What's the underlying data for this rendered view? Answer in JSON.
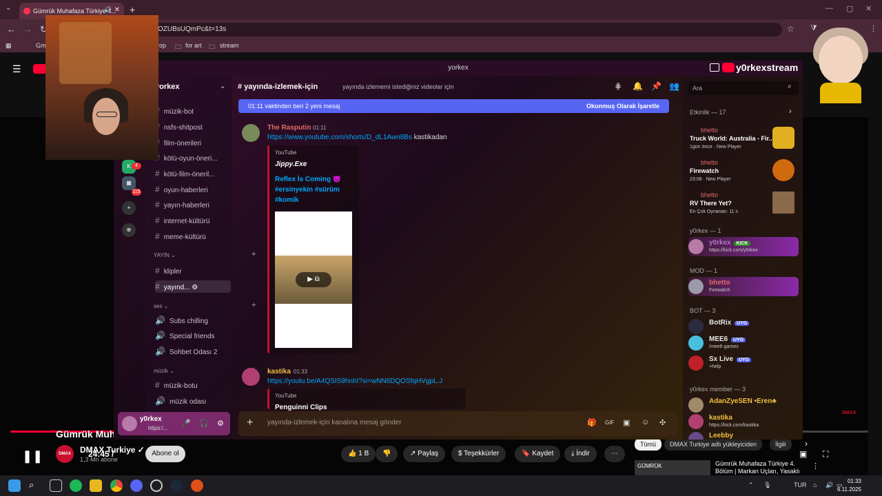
{
  "browser": {
    "tab_title": "Gümrük Muhafaza Türkiye 4...",
    "url": "OZUBsUQmPc&t=13s",
    "bookmarks": [
      "Gm",
      "rop",
      "for art",
      "stream"
    ]
  },
  "discord": {
    "topbar_title": "yorkex",
    "server_name": "yorkex",
    "channels": [
      "müzik-bot",
      "nsfs-shitpost",
      "film-önerileri",
      "kötü-oyun-öneri...",
      "kötü-film-öneril...",
      "oyun-haberleri",
      "yayın-haberleri",
      "internet-kültürü",
      "meme-kültürü"
    ],
    "category_yayin": "YAYIN",
    "yayin_channels": [
      "klipler",
      "yayınd..."
    ],
    "category_ses": "ses",
    "voice_channels": [
      "Subs chilling",
      "Special friends",
      "Sohbet Odası 2"
    ],
    "category_muzik": "müzik",
    "muzik_channels": [
      "müzik-botu",
      "müzik odası"
    ],
    "server_badges": [
      "4",
      "115"
    ],
    "user": {
      "name": "y0rkex",
      "status": "https:/..."
    },
    "current_channel": "yayında-izlemek-için",
    "topic": "yayında izlememi istediğiniz videolar için",
    "new_messages_banner": "01:11 vaktinden beri 2 yeni mesaj",
    "mark_read": "Okunmuş Olarak İşaretle",
    "messages": [
      {
        "author": "The Rasputin",
        "time": "01:11",
        "link": "https://www.youtube.com/shorts/D_dL1Awn8Bs",
        "text": "kastikadan",
        "embed": {
          "provider": "YouTube",
          "author": "Jippy.Exe",
          "title": "Reflex İs Coming 😈 #ersinyekin #sürüm #komik"
        }
      },
      {
        "author": "kastika",
        "time": "01:33",
        "link": "https://youtu.be/A4QSIS9hnhI?si=wNN6DQOSfqHVgpL.J",
        "embed": {
          "provider": "YouTube",
          "title": "Penguinni Clips"
        }
      }
    ],
    "composer_placeholder": "yayında-izlemek-için kanalına mesaj gönder",
    "members": {
      "search_placeholder": "Ara",
      "activity_header": "Etkinlik — 17",
      "activities": [
        {
          "user": "bhetto",
          "game": "Truck World: Australia - Fir...",
          "meta": "1gün önce · New Player"
        },
        {
          "user": "bhetto",
          "game": "Firewatch",
          "meta": "23:08 · New Player"
        },
        {
          "user": "bhetto",
          "game": "RV There Yet?",
          "meta": "En Çok Oynanan: 11 s"
        }
      ],
      "owner_header": "y0rkex — 1",
      "owner": {
        "name": "y0rkex",
        "tag": "KICK",
        "sub": "https://kick.com/y0rkex"
      },
      "mod_header": "MOD — 1",
      "mod": {
        "name": "bhetto",
        "sub": "Firewatch"
      },
      "bot_header": "BOT — 3",
      "bots": [
        {
          "name": "BotRix",
          "tag": "UYG",
          "sub": ""
        },
        {
          "name": "MEE6",
          "tag": "UYG",
          "sub": "/mee6-games"
        },
        {
          "name": "Sx Live",
          "tag": "UYG",
          "sub": "+help"
        }
      ],
      "member_header": "y0rkex member — 3",
      "members": [
        {
          "name": "AdanZyeSEN •Eren♣",
          "sub": ""
        },
        {
          "name": "kastika",
          "sub": "https://kick.com/kastika"
        },
        {
          "name": "Leebby",
          "sub": ""
        }
      ]
    }
  },
  "stream_overlay": {
    "name": "y0rkexstream"
  },
  "youtube": {
    "time": "24:45 /",
    "title": "Gümrük Muhafaza",
    "channel": "DMAX Turkiye",
    "channel_logo": "DMAX",
    "subs": "1,3 Mn abone",
    "subscribe": "Abone ol",
    "likes": "1 B",
    "share": "Paylaş",
    "thanks": "Teşekkürler",
    "save": "Kaydet",
    "download": "İndir",
    "chips": [
      "Tümü",
      "DMAX Turkiye adlı yükleyiciden",
      "İlgili"
    ],
    "side_video_title": "Gümrük Muhafaza Türkiye 4. Bölüm | Markan Uçları, Yasaklı",
    "side_thumb_text": "GÜMRÜK",
    "watermark": "DMAX"
  },
  "taskbar": {
    "lang": "TUR",
    "time": "01:33",
    "date": "6.11.2025"
  },
  "colors": {
    "accent": "#5865f2",
    "youtube_red": "#ff0033",
    "kick_green": "#53fc18"
  }
}
